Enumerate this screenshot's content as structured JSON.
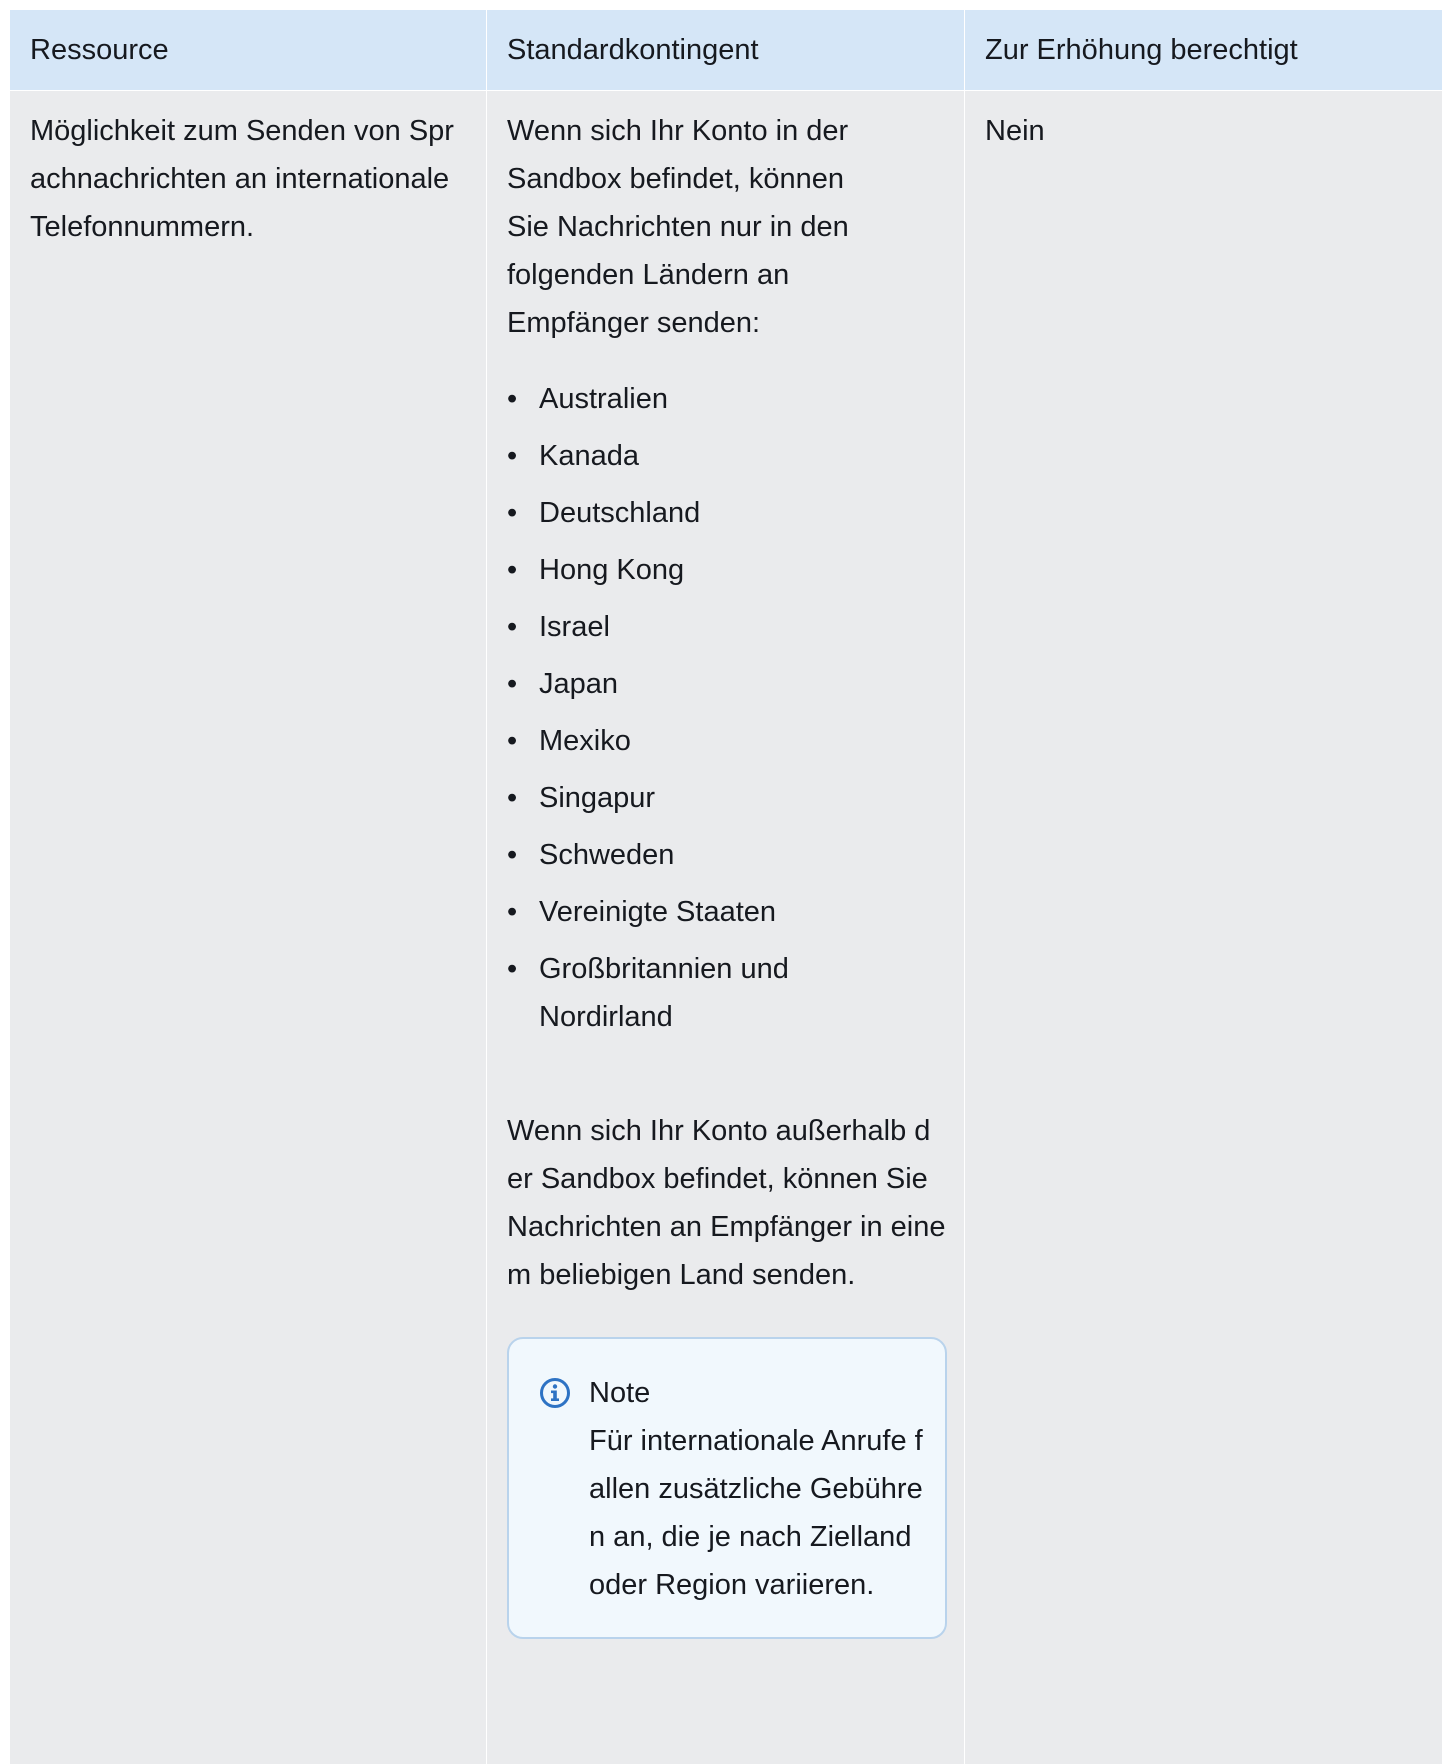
{
  "table": {
    "headers": [
      "Ressource",
      "Standardkontingent",
      "Zur Erhöhung berechtigt"
    ],
    "row": {
      "resource": "Möglichkeit zum Senden von Sprachnachrichten an internationale Telefonnummern.",
      "default_quota_intro": "Wenn sich Ihr Konto in der Sandbox befindet, können Sie Nachrichten nur in den folgenden Ländern an Empfänger senden:",
      "countries": [
        "Australien",
        "Kanada",
        "Deutschland",
        "Hong Kong",
        "Israel",
        "Japan",
        "Mexiko",
        "Singapur",
        "Schweden",
        "Vereinigte Staaten",
        "Großbritannien und Nordirland"
      ],
      "default_quota_outro": "Wenn sich Ihr Konto außerhalb der Sandbox befindet, können Sie Nachrichten an Empfänger in einem beliebigen Land senden.",
      "note": {
        "icon": "info-icon",
        "title": "Note",
        "body": "Für internationale Anrufe fallen zusätzliche Gebühren an, die je nach Zielland oder Region variieren."
      },
      "eligible": "Nein"
    }
  },
  "colors": {
    "header_bg": "#d5e6f7",
    "cell_bg": "#eaebed",
    "note_bg": "#f1f8fd",
    "note_border": "#b9d3ec",
    "info_icon": "#2e73c4"
  }
}
